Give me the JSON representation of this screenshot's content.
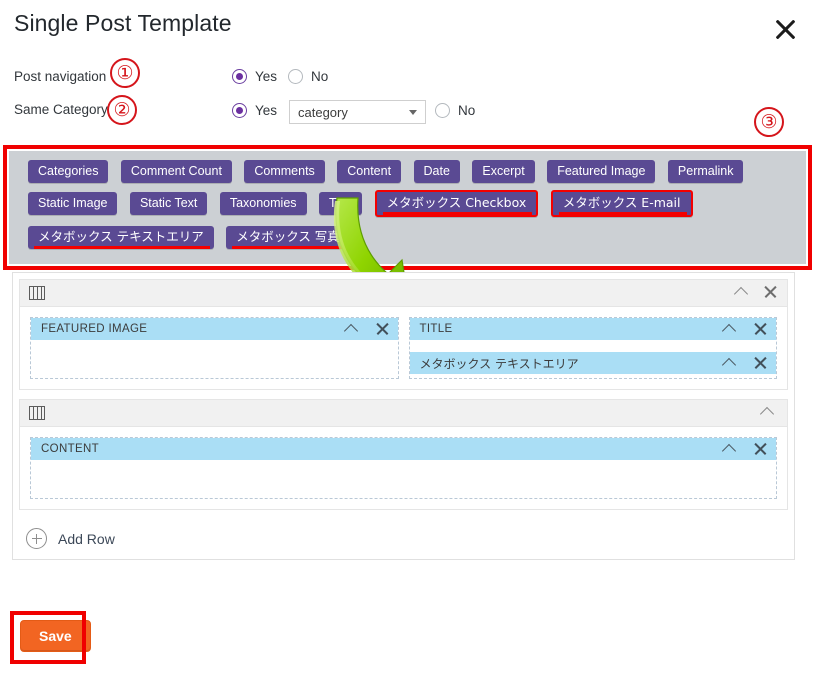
{
  "modal": {
    "title": "Single Post Template",
    "close_icon": "close-icon"
  },
  "form": {
    "post_navigation": {
      "label": "Post navigation",
      "yes_label": "Yes",
      "no_label": "No",
      "selected": "Yes",
      "annotation": "①"
    },
    "same_category": {
      "label": "Same Category",
      "yes_label": "Yes",
      "no_label": "No",
      "selected": "Yes",
      "dropdown_value": "category",
      "annotation": "②"
    }
  },
  "palette": {
    "annotation": "③",
    "background": "#ccd0d4",
    "tag_color": "#5a4a93",
    "highlight_color": "#f40000",
    "tags": [
      {
        "label": "Categories",
        "style": "plain"
      },
      {
        "label": "Comment Count",
        "style": "plain"
      },
      {
        "label": "Comments",
        "style": "plain"
      },
      {
        "label": "Content",
        "style": "plain"
      },
      {
        "label": "Date",
        "style": "plain"
      },
      {
        "label": "Excerpt",
        "style": "plain"
      },
      {
        "label": "Featured Image",
        "style": "plain"
      },
      {
        "label": "Permalink",
        "style": "plain"
      },
      {
        "label": "Static Image",
        "style": "plain"
      },
      {
        "label": "Static Text",
        "style": "plain"
      },
      {
        "label": "Taxonomies",
        "style": "plain"
      },
      {
        "label": "Title",
        "style": "plain"
      },
      {
        "label": "メタボックス Checkbox",
        "style": "boxed-underline"
      },
      {
        "label": "メタボックス E-mail",
        "style": "boxed-underline"
      },
      {
        "label": "メタボックス テキストエリア",
        "style": "underline"
      },
      {
        "label": "メタボックス 写真",
        "style": "underline"
      }
    ]
  },
  "arrow": {
    "name": "green-drag-arrow",
    "color": "#8ed600"
  },
  "builder": {
    "rows": [
      {
        "icon": "columns-icon",
        "collapse_icon": "chevron-up-icon",
        "remove_icon": "close-icon",
        "has_remove": true,
        "cells": [
          {
            "widgets": [
              {
                "label": "FEATURED IMAGE",
                "jp": false
              }
            ]
          },
          {
            "widgets": [
              {
                "label": "TITLE",
                "jp": false
              },
              {
                "label": "メタボックス テキストエリア",
                "jp": true
              }
            ]
          }
        ]
      },
      {
        "icon": "columns-icon",
        "collapse_icon": "chevron-up-icon",
        "remove_icon": "close-icon",
        "has_remove": false,
        "cells": [
          {
            "widgets": [
              {
                "label": "CONTENT",
                "jp": false
              }
            ]
          }
        ]
      }
    ],
    "add_row_label": "Add Row",
    "add_row_icon": "plus-circle-icon"
  },
  "save": {
    "label": "Save",
    "color": "#f26522",
    "annotation_box_color": "#f00000"
  }
}
